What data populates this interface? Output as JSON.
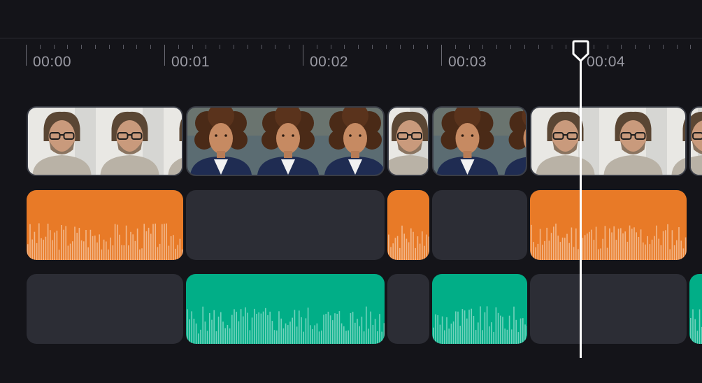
{
  "timeline": {
    "ruler": {
      "labels": [
        "00:00",
        "00:01",
        "00:02",
        "00:03",
        "00:04"
      ]
    },
    "video_track": {
      "clips": [
        {
          "kind": "video",
          "subject": "man-with-glasses"
        },
        {
          "kind": "video",
          "subject": "woman-curly-hair"
        },
        {
          "kind": "video",
          "subject": "man-with-glasses"
        },
        {
          "kind": "video",
          "subject": "woman-curly-hair"
        },
        {
          "kind": "video",
          "subject": "man-with-glasses"
        },
        {
          "kind": "video",
          "subject": "man-with-glasses"
        }
      ]
    },
    "audio_track_1": {
      "color": "#e87a27",
      "clips": [
        "audio",
        "empty",
        "audio",
        "empty",
        "audio"
      ]
    },
    "audio_track_2": {
      "color": "#01ae87",
      "clips": [
        "empty",
        "audio",
        "empty",
        "audio",
        "empty",
        "audio"
      ]
    },
    "playhead": {
      "position": "00:03.9"
    },
    "colors": {
      "background": "#141419",
      "empty_slot": "#2c2d35",
      "orange": "#e87a27",
      "green": "#01ae87",
      "playhead": "#ffffff"
    }
  }
}
